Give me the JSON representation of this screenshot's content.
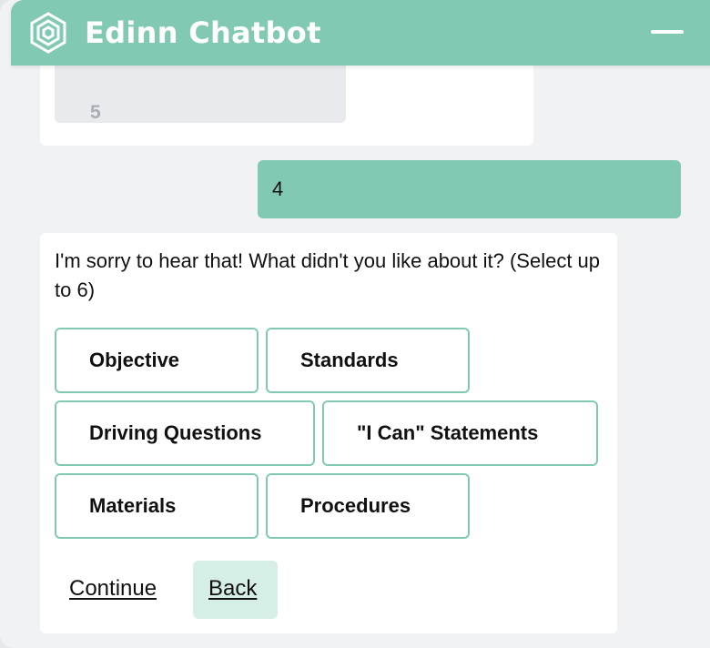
{
  "header": {
    "title": "Edinn Chatbot",
    "logo_icon": "hexagon-logo-icon",
    "minimize_icon": "minimize-icon"
  },
  "colors": {
    "accent": "#82c9b3",
    "accent_light": "#d6efe6",
    "background": "#f1f2f4",
    "card": "#ffffff"
  },
  "history": {
    "previous_option": "5",
    "user_reply": "4"
  },
  "bot": {
    "question": "I'm sorry to hear that! What didn't you like about it? (Select up to 6)",
    "options": [
      "Objective",
      "Standards",
      "Driving Questions",
      "\"I Can\" Statements",
      "Materials",
      "Procedures"
    ],
    "continue_label": "Continue",
    "back_label": "Back"
  }
}
